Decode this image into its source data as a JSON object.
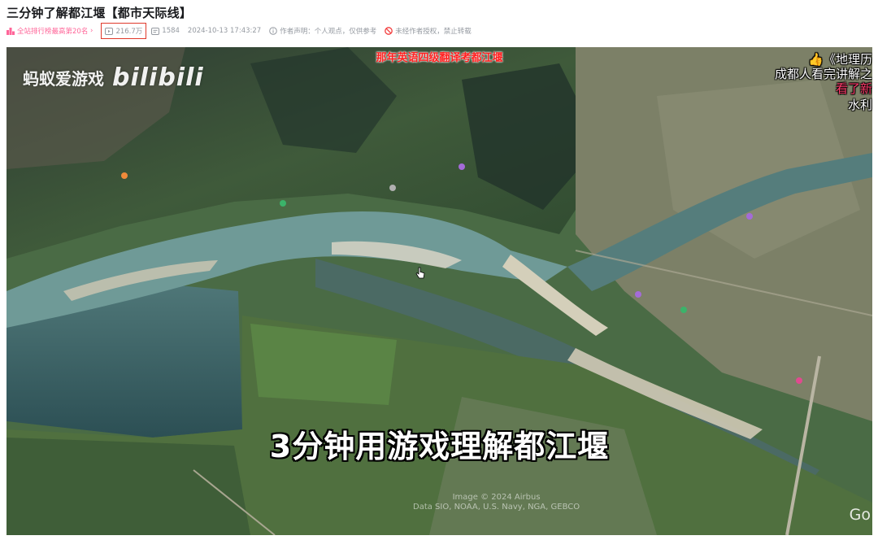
{
  "page": {
    "title": "三分钟了解都江堰【都市天际线】"
  },
  "meta": {
    "rank": "全站排行榜最高第20名",
    "views": "216.7万",
    "danmaku": "1584",
    "date": "2024-10-13 17:43:27",
    "statement": "作者声明：个人观点，仅供参考",
    "forbid": "未经作者授权，禁止转载",
    "rank_color": "#ff6699",
    "highlight_color": "#e0392b"
  },
  "video": {
    "watermark_channel": "蚂蚁爱游戏",
    "watermark_logo": "bilibili",
    "top_caption": "那年英语四级翻译考都江堰",
    "subtitle": "3分钟用游戏理解都江堰",
    "danmu": [
      "《地理历",
      "成都人看完讲解之",
      "看了新",
      "水利"
    ],
    "copyright_line1": "Image © 2024 Airbus",
    "copyright_line2": "Data SIO, NOAA, U.S. Navy, NGA, GEBCO",
    "google_mark": "Go",
    "caption_color": "#ff2020"
  }
}
